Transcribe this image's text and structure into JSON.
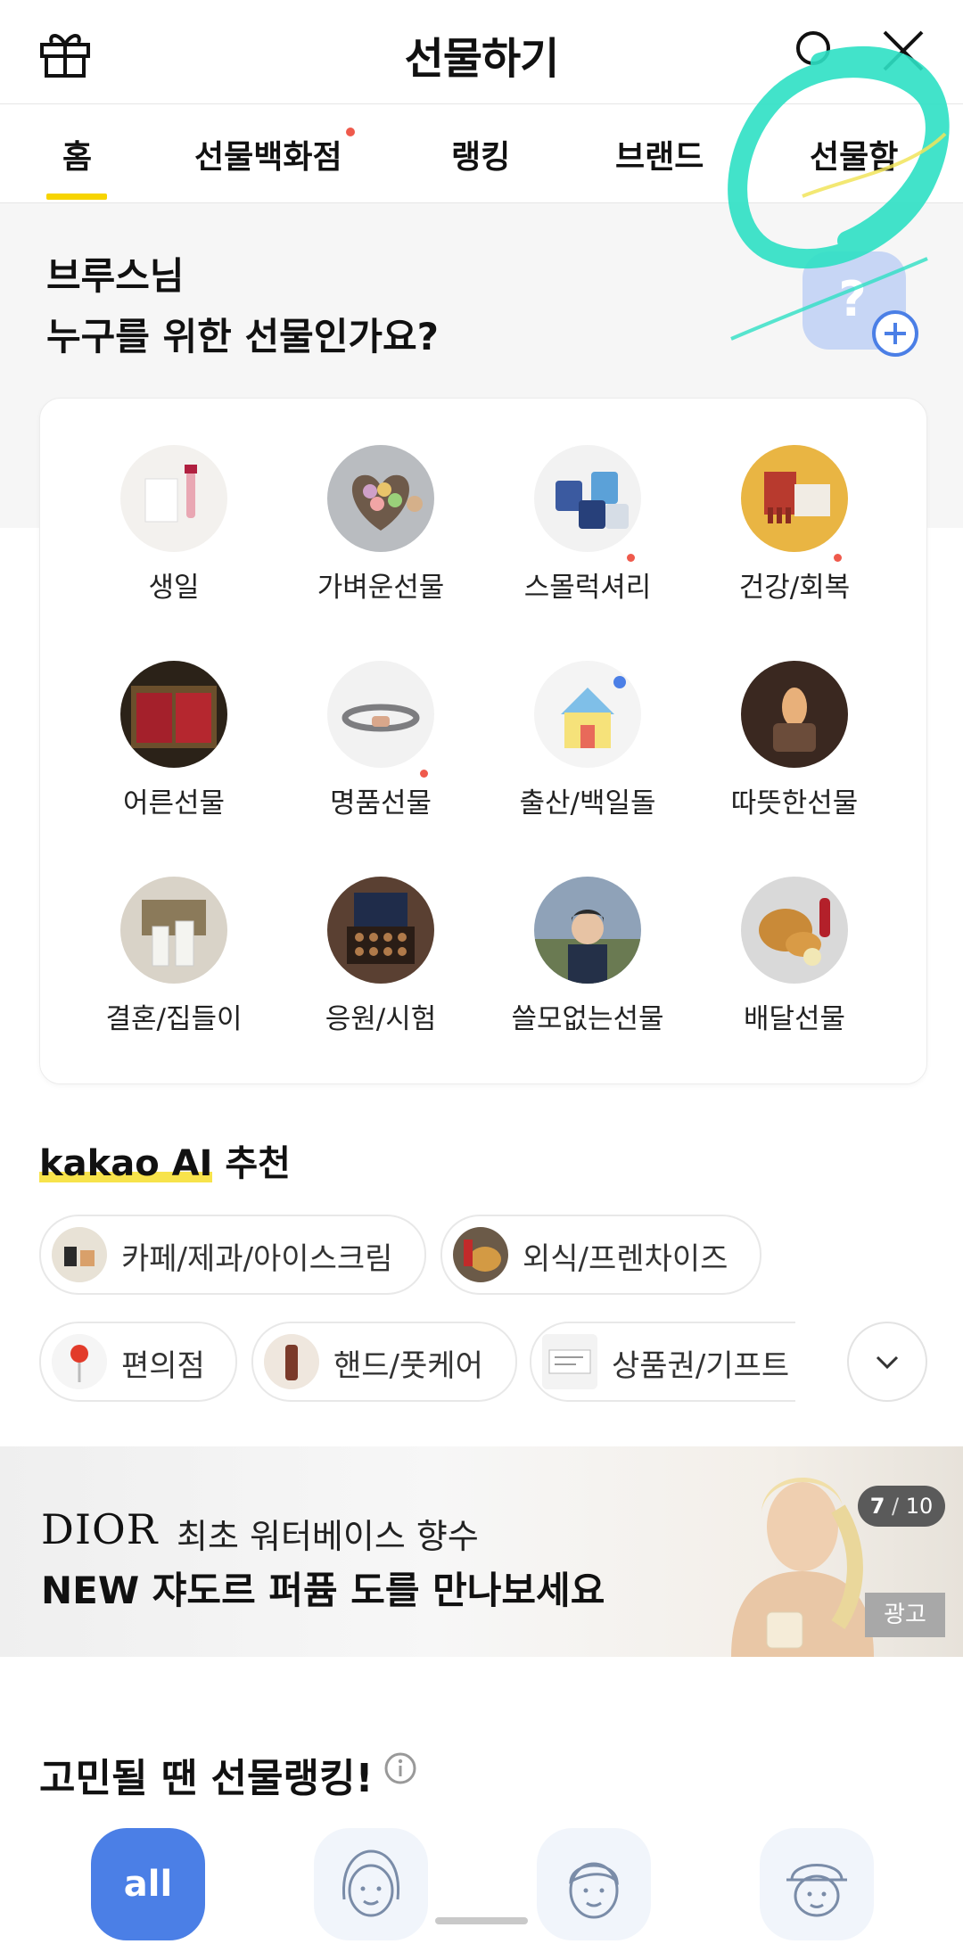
{
  "header": {
    "title": "선물하기",
    "icons": {
      "left": "gift-icon",
      "search": "search-icon",
      "close": "close-icon"
    }
  },
  "tabs": [
    {
      "label": "홈",
      "active": true,
      "dot": false
    },
    {
      "label": "선물백화점",
      "active": false,
      "dot": true
    },
    {
      "label": "랭킹",
      "active": false,
      "dot": false
    },
    {
      "label": "브랜드",
      "active": false,
      "dot": false
    },
    {
      "label": "선물함",
      "active": false,
      "dot": false
    }
  ],
  "greeting": {
    "name": "브루스님",
    "question": "누구를 위한 선물인가요?"
  },
  "categories": [
    {
      "label": "생일",
      "dot": false
    },
    {
      "label": "가벼운선물",
      "dot": false
    },
    {
      "label": "스몰럭셔리",
      "dot": true
    },
    {
      "label": "건강/회복",
      "dot": true
    },
    {
      "label": "어른선물",
      "dot": false
    },
    {
      "label": "명품선물",
      "dot": true
    },
    {
      "label": "출산/백일돌",
      "dot": false
    },
    {
      "label": "따뜻한선물",
      "dot": false
    },
    {
      "label": "결혼/집들이",
      "dot": false
    },
    {
      "label": "응원/시험",
      "dot": false
    },
    {
      "label": "쓸모없는선물",
      "dot": false
    },
    {
      "label": "배달선물",
      "dot": false
    }
  ],
  "ai": {
    "brand": "kakao AI",
    "suffix": "추천",
    "chips": [
      {
        "label": "카페/제과/아이스크림"
      },
      {
        "label": "외식/프렌차이즈"
      },
      {
        "label": "편의점"
      },
      {
        "label": "핸드/풋케어"
      },
      {
        "label": "상품권/기프트"
      }
    ]
  },
  "banner": {
    "brand": "DIOR",
    "line1": "최초 워터베이스 향수",
    "line2": "NEW 쟈도르 퍼퓸 도를 만나보세요",
    "page_current": "7",
    "page_total": "10",
    "ad_label": "광고"
  },
  "ranking": {
    "title": "고민될 땐 선물랭킹!",
    "buttons": [
      {
        "label": "all",
        "active": true
      },
      {
        "label": "",
        "icon": "woman-face-icon"
      },
      {
        "label": "",
        "icon": "man-face-icon"
      },
      {
        "label": "",
        "icon": "child-face-icon"
      }
    ]
  },
  "colors": {
    "accent_yellow": "#f7d400",
    "dot_red": "#ef5a4c",
    "rank_blue": "#4b7fe6",
    "scribble": "#2ee0c4"
  }
}
